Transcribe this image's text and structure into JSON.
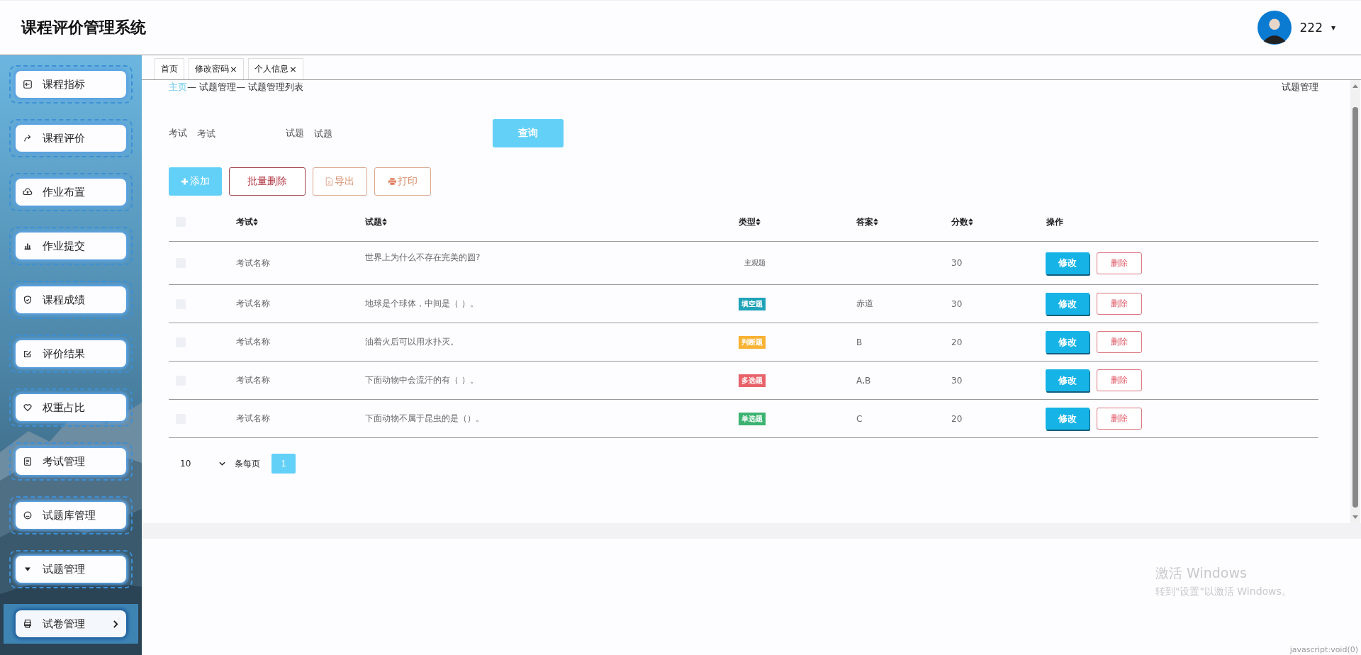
{
  "header": {
    "title": "课程评价管理系统",
    "user": {
      "name": "222",
      "menu_icon": "▾"
    }
  },
  "sidebar": {
    "items": [
      {
        "label": "课程指标",
        "selected": false
      },
      {
        "label": "课程评价",
        "selected": false
      },
      {
        "label": "作业布置",
        "selected": false
      },
      {
        "label": "作业提交",
        "selected": false
      },
      {
        "label": "课程成绩",
        "selected": false
      },
      {
        "label": "评价结果",
        "selected": false
      },
      {
        "label": "权重占比",
        "selected": false
      },
      {
        "label": "考试管理",
        "selected": false
      },
      {
        "label": "试题库管理",
        "selected": false
      },
      {
        "label": "试题管理",
        "selected": false
      },
      {
        "label": "试卷管理",
        "selected": true
      }
    ]
  },
  "tabs": [
    {
      "label": "首页"
    },
    {
      "label": "修改密码",
      "close_icon": "×"
    },
    {
      "label": "个人信息",
      "close_icon": "×"
    }
  ],
  "breadcrumb": {
    "items": [
      "主页",
      "试题管理",
      "试题管理列表"
    ],
    "separator": "—",
    "page_title": "试题管理"
  },
  "search": {
    "fields": [
      {
        "label": "考试",
        "placeholder": "考试"
      },
      {
        "label": "试题",
        "placeholder": "试题"
      }
    ],
    "button": "查询"
  },
  "toolbar": [
    {
      "kind": "add",
      "label": "添加"
    },
    {
      "kind": "delete",
      "label": "批量删除"
    },
    {
      "kind": "export",
      "label": "导出"
    },
    {
      "kind": "print",
      "label": "打印"
    }
  ],
  "table": {
    "select_all": {
      "checked": false
    },
    "columns": [
      {
        "label": "考试",
        "sortable": true
      },
      {
        "label": "试题",
        "sortable": true
      },
      {
        "label": "类型",
        "sortable": true
      },
      {
        "label": "答案",
        "sortable": true
      },
      {
        "label": "分数",
        "sortable": true
      },
      {
        "label": "操作",
        "sortable": false
      }
    ],
    "rows": [
      {
        "checked": false,
        "exam": "考试名称",
        "question": "世界上为什么不存在完美的圆?",
        "type": {
          "label": "主观题"
        },
        "answer": "",
        "score": "30",
        "actions": [
          "修改",
          "删除"
        ]
      },
      {
        "checked": false,
        "exam": "考试名称",
        "question": "地球是个球体，中间是（ ）。",
        "type": {
          "label": "填空题",
          "color": "#1fa3b8"
        },
        "answer": "赤道",
        "score": "30",
        "actions": [
          "修改",
          "删除"
        ]
      },
      {
        "checked": false,
        "exam": "考试名称",
        "question": "油着火后可以用水扑灭。",
        "type": {
          "label": "判断题",
          "color": "#f9b233"
        },
        "answer": "B",
        "score": "20",
        "actions": [
          "修改",
          "删除"
        ]
      },
      {
        "checked": false,
        "exam": "考试名称",
        "question": "下面动物中会流汗的有（ ）。",
        "type": {
          "label": "多选题",
          "color": "#e8626a"
        },
        "answer": "A,B",
        "score": "30",
        "actions": [
          "修改",
          "删除"
        ]
      },
      {
        "checked": false,
        "exam": "考试名称",
        "question": "下面动物不属于昆虫的是（）。",
        "type": {
          "label": "单选题",
          "color": "#3cb371"
        },
        "answer": "C",
        "score": "20",
        "actions": [
          "修改",
          "删除"
        ]
      }
    ]
  },
  "pagination": {
    "page_size": "10",
    "page_size_label": "条每页",
    "pages": [
      {
        "label": "1",
        "selected": true
      }
    ]
  },
  "os_overlay": {
    "title": "激活 Windows",
    "subtitle": "转到\"设置\"以激活 Windows。",
    "status": "javascript:void(0)"
  }
}
